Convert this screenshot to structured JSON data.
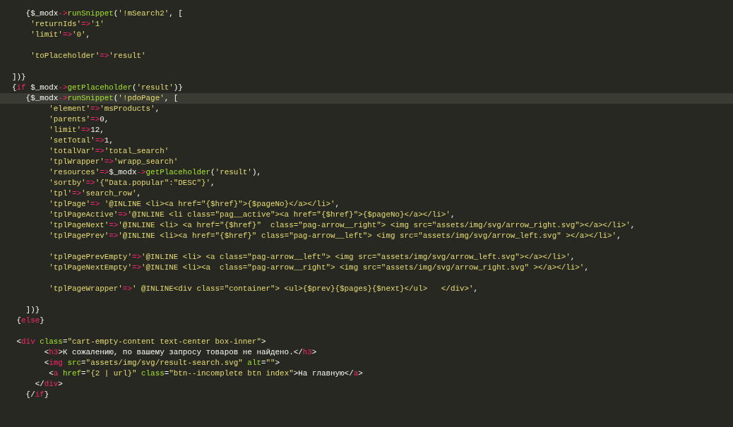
{
  "editor": {
    "lines": [
      {
        "current": false,
        "tokens": [
          {
            "kind": "p",
            "text": "   {$_modx"
          },
          {
            "kind": "o",
            "text": "->"
          },
          {
            "kind": "f",
            "text": "runSnippet"
          },
          {
            "kind": "p",
            "text": "("
          },
          {
            "kind": "s",
            "text": "'!mSearch2'"
          },
          {
            "kind": "p",
            "text": ", ["
          }
        ]
      },
      {
        "current": false,
        "tokens": [
          {
            "kind": "s",
            "text": "    'returnIds'"
          },
          {
            "kind": "o",
            "text": "=>"
          },
          {
            "kind": "s",
            "text": "'1'"
          }
        ]
      },
      {
        "current": false,
        "tokens": [
          {
            "kind": "s",
            "text": "    'limit'"
          },
          {
            "kind": "o",
            "text": "=>"
          },
          {
            "kind": "s",
            "text": "'0'"
          },
          {
            "kind": "p",
            "text": ","
          }
        ]
      },
      {
        "current": false
      },
      {
        "current": false,
        "tokens": [
          {
            "kind": "s",
            "text": "    'toPlaceholder'"
          },
          {
            "kind": "o",
            "text": "=>"
          },
          {
            "kind": "s",
            "text": "'result'"
          }
        ]
      },
      {
        "current": false
      },
      {
        "current": false,
        "tokens": [
          {
            "kind": "p",
            "text": "])}"
          }
        ]
      },
      {
        "current": false,
        "tokens": [
          {
            "kind": "p",
            "text": "{"
          },
          {
            "kind": "o",
            "text": "if"
          },
          {
            "kind": "p",
            "text": " $_modx"
          },
          {
            "kind": "o",
            "text": "->"
          },
          {
            "kind": "f",
            "text": "getPlaceholder"
          },
          {
            "kind": "p",
            "text": "("
          },
          {
            "kind": "s",
            "text": "'result'"
          },
          {
            "kind": "p",
            "text": ")}"
          }
        ]
      },
      {
        "current": true,
        "tokens": [
          {
            "kind": "p",
            "text": "   {$_modx"
          },
          {
            "kind": "o",
            "text": "->"
          },
          {
            "kind": "f",
            "text": "runSnippet"
          },
          {
            "kind": "p",
            "text": "("
          },
          {
            "kind": "s",
            "text": "'!pdoPage'"
          },
          {
            "kind": "p",
            "text": ", ["
          }
        ]
      },
      {
        "current": false,
        "tokens": [
          {
            "kind": "s",
            "text": "        'element'"
          },
          {
            "kind": "o",
            "text": "=>"
          },
          {
            "kind": "s",
            "text": "'msProducts'"
          },
          {
            "kind": "p",
            "text": ","
          }
        ]
      },
      {
        "current": false,
        "tokens": [
          {
            "kind": "s",
            "text": "        'parents'"
          },
          {
            "kind": "o",
            "text": "=>"
          },
          {
            "kind": "p",
            "text": "0,"
          }
        ]
      },
      {
        "current": false,
        "tokens": [
          {
            "kind": "s",
            "text": "        'limit'"
          },
          {
            "kind": "o",
            "text": "=>"
          },
          {
            "kind": "p",
            "text": "12,"
          }
        ]
      },
      {
        "current": false,
        "tokens": [
          {
            "kind": "s",
            "text": "        'setTotal'"
          },
          {
            "kind": "o",
            "text": "=>"
          },
          {
            "kind": "p",
            "text": "1,"
          }
        ]
      },
      {
        "current": false,
        "tokens": [
          {
            "kind": "s",
            "text": "        'totalVar'"
          },
          {
            "kind": "o",
            "text": "=>"
          },
          {
            "kind": "s",
            "text": "'total_search'"
          }
        ]
      },
      {
        "current": false,
        "tokens": [
          {
            "kind": "s",
            "text": "        'tplWrapper'"
          },
          {
            "kind": "o",
            "text": "=>"
          },
          {
            "kind": "s",
            "text": "'wrapp_search'"
          }
        ]
      },
      {
        "current": false,
        "tokens": [
          {
            "kind": "s",
            "text": "        'resources'"
          },
          {
            "kind": "o",
            "text": "=>"
          },
          {
            "kind": "p",
            "text": "$_modx"
          },
          {
            "kind": "o",
            "text": "->"
          },
          {
            "kind": "f",
            "text": "getPlaceholder"
          },
          {
            "kind": "p",
            "text": "("
          },
          {
            "kind": "s",
            "text": "'result'"
          },
          {
            "kind": "p",
            "text": "),"
          }
        ]
      },
      {
        "current": false,
        "tokens": [
          {
            "kind": "s",
            "text": "        'sortby'"
          },
          {
            "kind": "o",
            "text": "=>"
          },
          {
            "kind": "s",
            "text": "'{\"Data.popular\":\"DESC\"}'"
          },
          {
            "kind": "p",
            "text": ","
          }
        ]
      },
      {
        "current": false,
        "tokens": [
          {
            "kind": "s",
            "text": "        'tpl'"
          },
          {
            "kind": "o",
            "text": "=>"
          },
          {
            "kind": "s",
            "text": "'search_row'"
          },
          {
            "kind": "p",
            "text": ","
          }
        ]
      },
      {
        "current": false,
        "tokens": [
          {
            "kind": "s",
            "text": "        'tplPage'"
          },
          {
            "kind": "o",
            "text": "=>"
          },
          {
            "kind": "s",
            "text": " '@INLINE <li><a href=\"{$href}\">{$pageNo}</a></li>'"
          },
          {
            "kind": "p",
            "text": ","
          }
        ]
      },
      {
        "current": false,
        "tokens": [
          {
            "kind": "s",
            "text": "        'tplPageActive'"
          },
          {
            "kind": "o",
            "text": "=>"
          },
          {
            "kind": "s",
            "text": "'@INLINE <li class=\"pag__active\"><a href=\"{$href}\">{$pageNo}</a></li>'"
          },
          {
            "kind": "p",
            "text": ","
          }
        ]
      },
      {
        "current": false,
        "tokens": [
          {
            "kind": "s",
            "text": "        'tplPageNext'"
          },
          {
            "kind": "o",
            "text": "=>"
          },
          {
            "kind": "s",
            "text": "'@INLINE <li> <a href=\"{$href}\"  class=\"pag-arrow__right\"> <img src=\"assets/img/svg/arrow_right.svg\"></a></li>'"
          },
          {
            "kind": "p",
            "text": ","
          }
        ]
      },
      {
        "current": false,
        "tokens": [
          {
            "kind": "s",
            "text": "        'tplPagePrev'"
          },
          {
            "kind": "o",
            "text": "=>"
          },
          {
            "kind": "s",
            "text": "'@INLINE <li><a href=\"{$href}\" class=\"pag-arrow__left\"> <img src=\"assets/img/svg/arrow_left.svg\" ></a></li>'"
          },
          {
            "kind": "p",
            "text": ","
          }
        ]
      },
      {
        "current": false
      },
      {
        "current": false,
        "tokens": [
          {
            "kind": "s",
            "text": "        'tplPagePrevEmpty'"
          },
          {
            "kind": "o",
            "text": "=>"
          },
          {
            "kind": "s",
            "text": "'@INLINE <li> <a class=\"pag-arrow__left\"> <img src=\"assets/img/svg/arrow_left.svg\"></a></li>'"
          },
          {
            "kind": "p",
            "text": ","
          }
        ]
      },
      {
        "current": false,
        "tokens": [
          {
            "kind": "s",
            "text": "        'tplPageNextEmpty'"
          },
          {
            "kind": "o",
            "text": "=>"
          },
          {
            "kind": "s",
            "text": "'@INLINE <li><a  class=\"pag-arrow__right\"> <img src=\"assets/img/svg/arrow_right.svg\" ></a></li>'"
          },
          {
            "kind": "p",
            "text": ","
          }
        ]
      },
      {
        "current": false
      },
      {
        "current": false,
        "tokens": [
          {
            "kind": "s",
            "text": "        'tplPageWrapper'"
          },
          {
            "kind": "o",
            "text": "=>"
          },
          {
            "kind": "s",
            "text": "' @INLINE<div class=\"container\"> <ul>{$prev}{$pages}{$next}</ul>   </div>'"
          },
          {
            "kind": "p",
            "text": ","
          }
        ]
      },
      {
        "current": false
      },
      {
        "current": false,
        "tokens": [
          {
            "kind": "p",
            "text": "   ])}"
          }
        ]
      },
      {
        "current": false,
        "tokens": [
          {
            "kind": "p",
            "text": " {"
          },
          {
            "kind": "o",
            "text": "else"
          },
          {
            "kind": "p",
            "text": "}"
          }
        ]
      },
      {
        "current": false
      },
      {
        "current": false,
        "tokens": [
          {
            "kind": "p",
            "text": " <"
          },
          {
            "kind": "o",
            "text": "div"
          },
          {
            "kind": "f",
            "text": " class"
          },
          {
            "kind": "p",
            "text": "="
          },
          {
            "kind": "s",
            "text": "\"cart-empty-content text-center box-inner\""
          },
          {
            "kind": "p",
            "text": ">"
          }
        ]
      },
      {
        "current": false,
        "tokens": [
          {
            "kind": "p",
            "text": "       <"
          },
          {
            "kind": "o",
            "text": "h3"
          },
          {
            "kind": "p",
            "text": ">К сожалению, по вашему запросу товаров не найдено.</"
          },
          {
            "kind": "o",
            "text": "h3"
          },
          {
            "kind": "p",
            "text": ">"
          }
        ]
      },
      {
        "current": false,
        "tokens": [
          {
            "kind": "p",
            "text": "       <"
          },
          {
            "kind": "o",
            "text": "img"
          },
          {
            "kind": "f",
            "text": " src"
          },
          {
            "kind": "p",
            "text": "="
          },
          {
            "kind": "s",
            "text": "\"assets/img/svg/result-search.svg\""
          },
          {
            "kind": "f",
            "text": " alt"
          },
          {
            "kind": "p",
            "text": "="
          },
          {
            "kind": "s",
            "text": "\"\""
          },
          {
            "kind": "p",
            "text": ">"
          }
        ]
      },
      {
        "current": false,
        "tokens": [
          {
            "kind": "p",
            "text": "        <"
          },
          {
            "kind": "o",
            "text": "a"
          },
          {
            "kind": "f",
            "text": " href"
          },
          {
            "kind": "p",
            "text": "="
          },
          {
            "kind": "s",
            "text": "\"{2 | url}\""
          },
          {
            "kind": "f",
            "text": " class"
          },
          {
            "kind": "p",
            "text": "="
          },
          {
            "kind": "s",
            "text": "\"btn--incomplete btn index\""
          },
          {
            "kind": "p",
            "text": ">На главную</"
          },
          {
            "kind": "o",
            "text": "a"
          },
          {
            "kind": "p",
            "text": ">"
          }
        ]
      },
      {
        "current": false,
        "tokens": [
          {
            "kind": "p",
            "text": "     </"
          },
          {
            "kind": "o",
            "text": "div"
          },
          {
            "kind": "p",
            "text": ">"
          }
        ]
      },
      {
        "current": false,
        "tokens": [
          {
            "kind": "p",
            "text": "   {/"
          },
          {
            "kind": "o",
            "text": "if"
          },
          {
            "kind": "p",
            "text": "}"
          }
        ]
      }
    ]
  }
}
